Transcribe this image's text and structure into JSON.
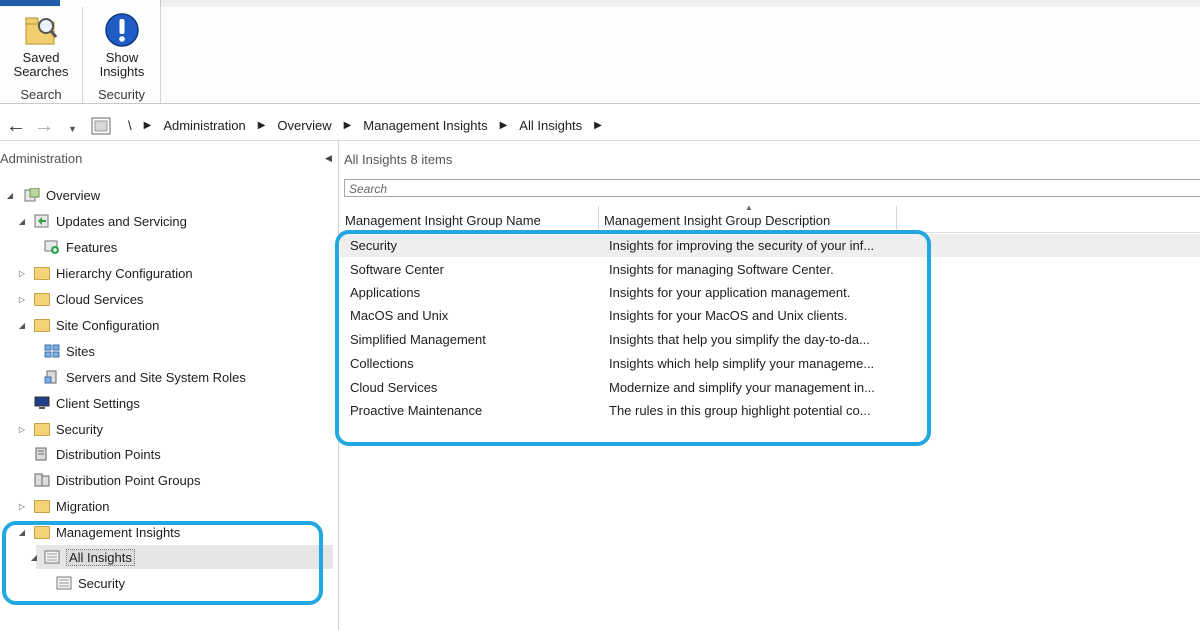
{
  "ribbon": {
    "saved_searches": "Saved\nSearches",
    "group_search": "Search",
    "show_insights": "Show\nInsights",
    "group_security": "Security"
  },
  "breadcrumb": {
    "root": "\\",
    "items": [
      "Administration",
      "Overview",
      "Management Insights",
      "All Insights"
    ]
  },
  "left_pane": {
    "title": "Administration",
    "tree": [
      {
        "label": "Overview",
        "icon": "overview-icon"
      },
      {
        "label": "Updates and Servicing",
        "icon": "updates-icon"
      },
      {
        "label": "Features",
        "icon": "features-icon"
      },
      {
        "label": "Hierarchy Configuration",
        "icon": "folder-icon"
      },
      {
        "label": "Cloud Services",
        "icon": "folder-icon"
      },
      {
        "label": "Site Configuration",
        "icon": "folder-icon"
      },
      {
        "label": "Sites",
        "icon": "sites-icon"
      },
      {
        "label": "Servers and Site System Roles",
        "icon": "servers-icon"
      },
      {
        "label": "Client Settings",
        "icon": "client-settings-icon"
      },
      {
        "label": "Security",
        "icon": "folder-icon"
      },
      {
        "label": "Distribution Points",
        "icon": "distribution-icon"
      },
      {
        "label": "Distribution Point Groups",
        "icon": "distribution-groups-icon"
      },
      {
        "label": "Migration",
        "icon": "folder-icon"
      },
      {
        "label": "Management Insights",
        "icon": "folder-icon"
      },
      {
        "label": "All Insights",
        "icon": "list-icon"
      },
      {
        "label": "Security",
        "icon": "list-icon"
      }
    ]
  },
  "main": {
    "title": "All Insights 8 items",
    "search_placeholder": "Search",
    "columns": [
      "Management Insight Group Name",
      "Management Insight Group Description"
    ],
    "rows": [
      {
        "name": "Security",
        "desc": "Insights for improving the security of your inf..."
      },
      {
        "name": "Software Center",
        "desc": "Insights for managing Software Center."
      },
      {
        "name": "Applications",
        "desc": "Insights for your application management."
      },
      {
        "name": "MacOS and Unix",
        "desc": "Insights for your MacOS and Unix clients."
      },
      {
        "name": "Simplified Management",
        "desc": "Insights that help you simplify the day-to-da..."
      },
      {
        "name": "Collections",
        "desc": "Insights which help simplify your manageme..."
      },
      {
        "name": "Cloud Services",
        "desc": "Modernize and simplify your management in..."
      },
      {
        "name": "Proactive Maintenance",
        "desc": "The rules in this group highlight potential co..."
      }
    ]
  },
  "colors": {
    "highlight": "#22a8e0",
    "ribbon_accent": "#1e5ea8"
  }
}
